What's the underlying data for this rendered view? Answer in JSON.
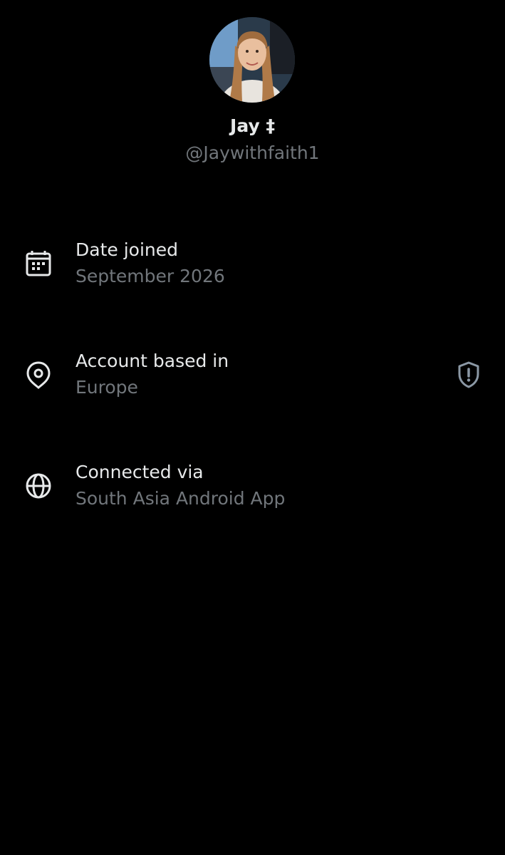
{
  "profile": {
    "display_name": "Jay ‡",
    "handle": "@Jaywithfaith1",
    "avatar": "profile-photo"
  },
  "about": {
    "rows": [
      {
        "label": "Date joined",
        "value": "September 2026",
        "icon": "calendar-icon"
      },
      {
        "label": "Account based in",
        "value": "Europe",
        "icon": "location-pin-icon",
        "trailing_icon": "shield-alert-icon"
      },
      {
        "label": "Connected via",
        "value": "South Asia Android App",
        "icon": "globe-icon"
      }
    ]
  },
  "colors": {
    "background": "#000000",
    "primary_text": "#e7e9ea",
    "secondary_text": "#71767b",
    "shield_icon": "#8b98a5"
  }
}
